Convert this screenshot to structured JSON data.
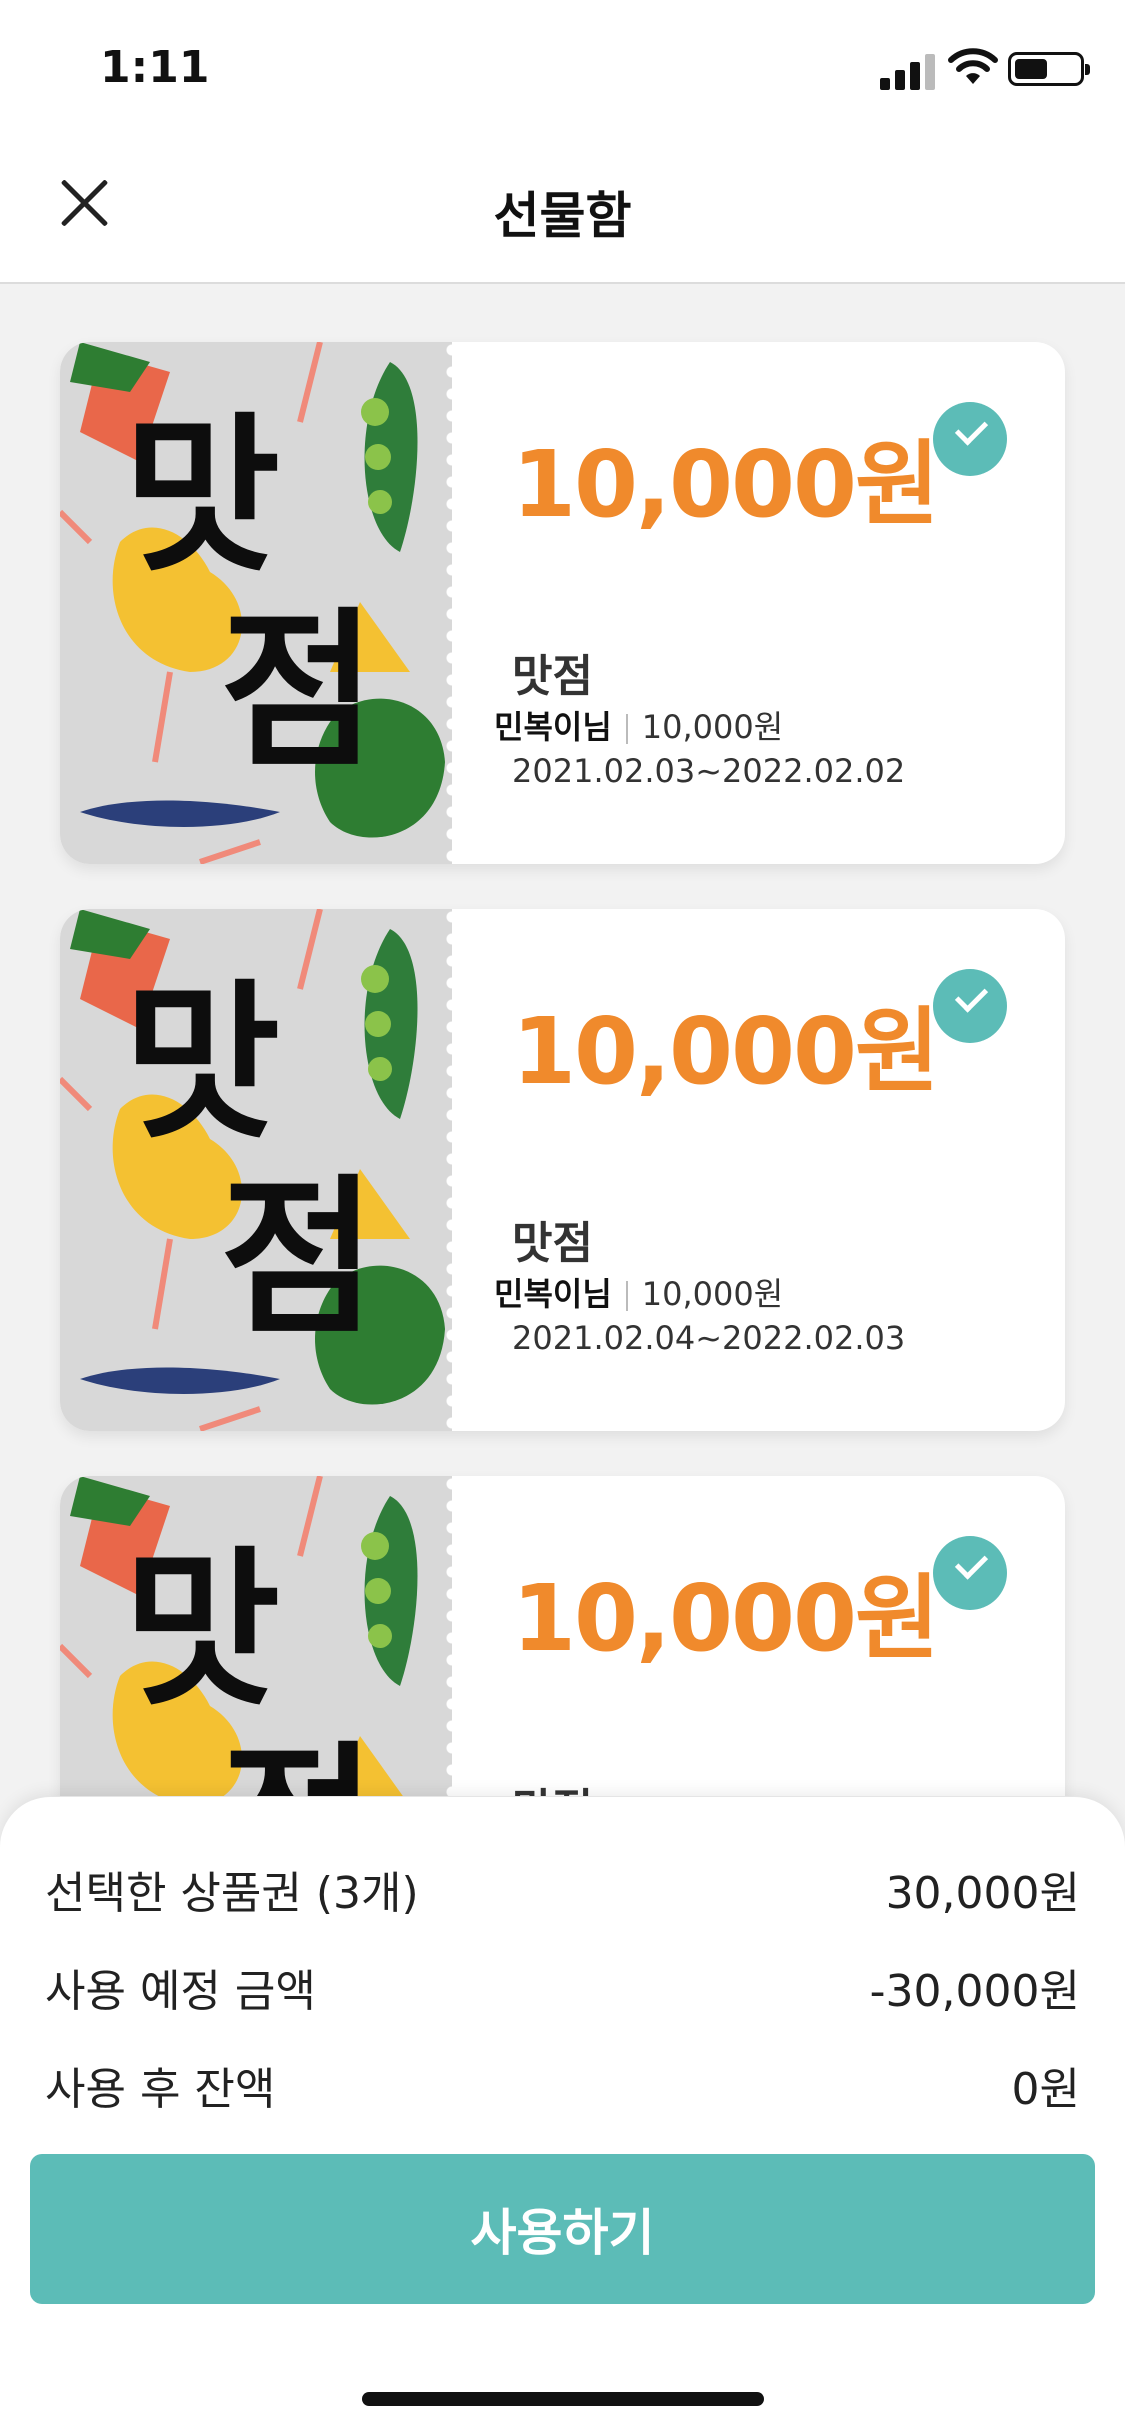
{
  "status_bar": {
    "time": "1:11"
  },
  "header": {
    "title": "선물함"
  },
  "vouchers": [
    {
      "amount": "10,000원",
      "name": "맛점",
      "issuer": "민복이님",
      "value": "10,000원",
      "period": "2021.02.03~2022.02.02",
      "art_top": "맛",
      "art_bottom": "점",
      "selected": true
    },
    {
      "amount": "10,000원",
      "name": "맛점",
      "issuer": "민복이님",
      "value": "10,000원",
      "period": "2021.02.04~2022.02.03",
      "art_top": "맛",
      "art_bottom": "점",
      "selected": true
    },
    {
      "amount": "10,000원",
      "name": "맛점",
      "issuer": "",
      "value": "",
      "period": "",
      "art_top": "맛",
      "art_bottom": "점",
      "selected": true
    }
  ],
  "summary": {
    "selected_label": "선택한 상품권 (3개)",
    "selected_value": "30,000원",
    "planned_label": "사용 예정 금액",
    "planned_value": "-30,000원",
    "remaining_label": "사용 후 잔액",
    "remaining_value": "0원",
    "button_label": "사용하기"
  },
  "colors": {
    "accent": "#5cbcb7",
    "amount": "#f08a2c"
  }
}
